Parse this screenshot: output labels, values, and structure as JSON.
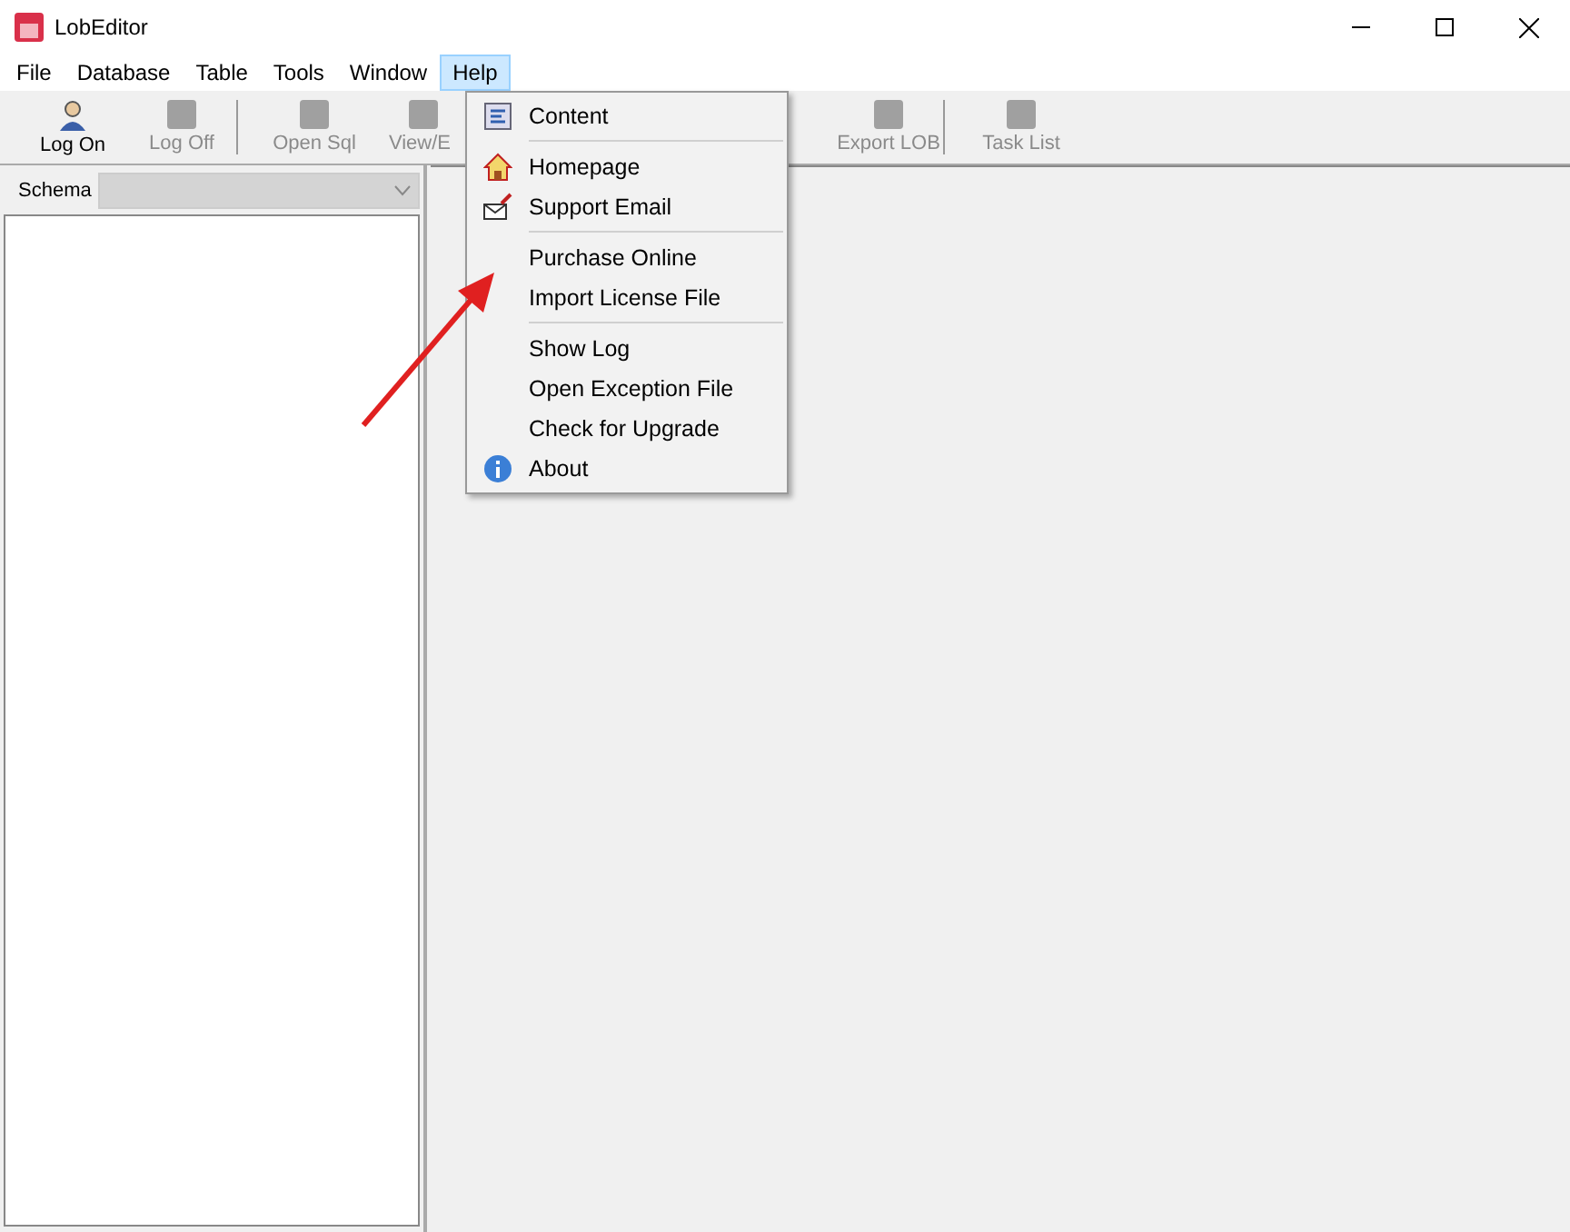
{
  "window": {
    "title": "LobEditor"
  },
  "menu_bar": [
    {
      "label": "File",
      "selected": false
    },
    {
      "label": "Database",
      "selected": false
    },
    {
      "label": "Table",
      "selected": false
    },
    {
      "label": "Tools",
      "selected": false
    },
    {
      "label": "Window",
      "selected": false
    },
    {
      "label": "Help",
      "selected": true
    }
  ],
  "toolbar": [
    {
      "label": "Log On",
      "disabled": false,
      "separator_after": false
    },
    {
      "label": "Log Off",
      "disabled": true,
      "separator_after": true
    },
    {
      "label": "Open Sql",
      "disabled": true,
      "separator_after": false
    },
    {
      "label": "View/E",
      "disabled": true,
      "separator_after": false
    },
    {
      "label": "Export LOB",
      "disabled": true,
      "separator_after": true
    },
    {
      "label": "Task List",
      "disabled": true,
      "separator_after": false
    }
  ],
  "schema": {
    "label": "Schema",
    "disabled": true
  },
  "help_menu": [
    {
      "kind": "item",
      "label": "Content"
    },
    {
      "kind": "separator"
    },
    {
      "kind": "item",
      "label": "Homepage"
    },
    {
      "kind": "item",
      "label": "Support Email"
    },
    {
      "kind": "separator"
    },
    {
      "kind": "item",
      "label": "Purchase Online"
    },
    {
      "kind": "item",
      "label": "Import License File"
    },
    {
      "kind": "separator"
    },
    {
      "kind": "item",
      "label": "Show Log"
    },
    {
      "kind": "item",
      "label": "Open Exception File"
    },
    {
      "kind": "item",
      "label": "Check for Upgrade"
    },
    {
      "kind": "item",
      "label": "About"
    }
  ]
}
